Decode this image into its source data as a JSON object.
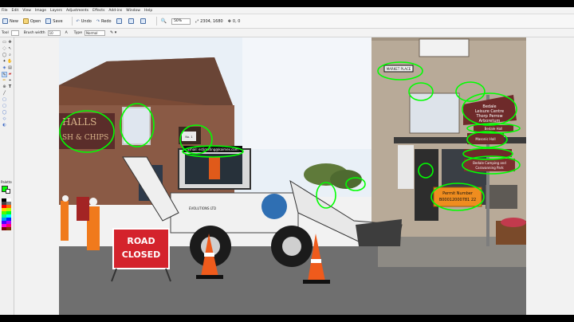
{
  "menu": [
    "File",
    "Edit",
    "View",
    "Image",
    "Layers",
    "Adjustments",
    "Effects",
    "Add-ins",
    "Window",
    "Help"
  ],
  "toolbar": {
    "new_label": "New",
    "open_label": "Open",
    "save_label": "Save",
    "undo_label": "Undo",
    "redo_label": "Redo",
    "zoom_value": "50%",
    "size_readout": "2304, 1680",
    "pos_readout": "0, 0"
  },
  "options": {
    "tool_label": "Tool",
    "brush_width_label": "Brush width",
    "brush_width_value": "10",
    "type_label": "Type",
    "type_value": "Normal"
  },
  "palette": {
    "title": "Palette"
  },
  "colors": {
    "primary": "#00ff00",
    "annotation": "#00ff00"
  },
  "photo": {
    "road_sign_line1": "ROAD",
    "road_sign_line2": "CLOSED",
    "shop_sign_line1": "HALLS",
    "shop_sign_line2": "SH & CHIPS",
    "digger_email": "Email: estimating@kaimex.com",
    "digger_brand": "EVOLUTIONS LTD",
    "street_sign": "MARKET PLACE",
    "fingerpost_line1": "Bedale",
    "fingerpost_line2": "Leisure Centre",
    "fingerpost_line3": "Thorp Perrow",
    "fingerpost_line4": "Arboretum",
    "sign_small_1": "Bedale Hall",
    "sign_small_2": "Masonic Hall",
    "sign_camping_line1": "Bedale Camping and",
    "sign_camping_line2": "Caravanning Park",
    "permit_line1": "Permit Number",
    "permit_line2": "B00012000781 22",
    "window_plaque": "No. 1"
  }
}
